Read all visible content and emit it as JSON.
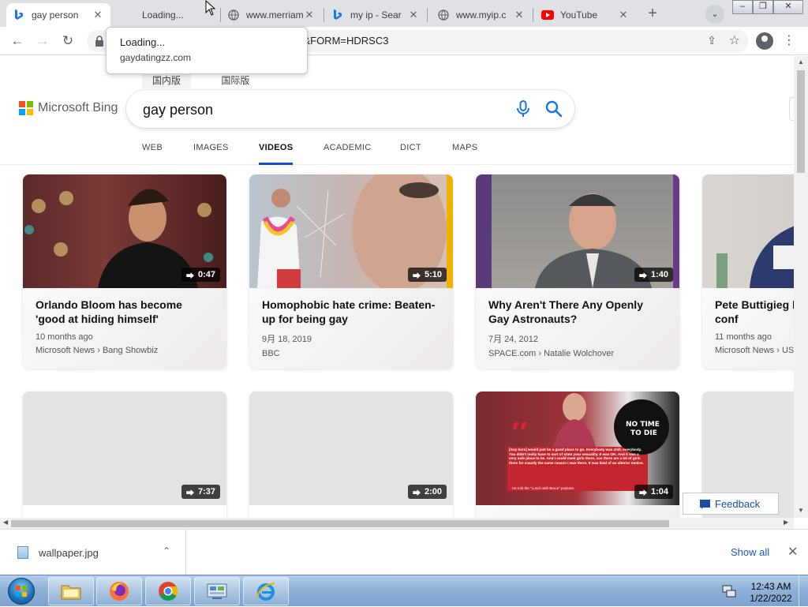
{
  "browser": {
    "tabs": [
      {
        "title": "gay person",
        "favicon": "bing-icon",
        "active": true
      },
      {
        "title": "Loading...",
        "favicon": "none",
        "active": false
      },
      {
        "title": "www.merriam",
        "favicon": "globe-icon",
        "active": false
      },
      {
        "title": "my ip - Sear",
        "favicon": "bing-icon",
        "active": false
      },
      {
        "title": "www.myip.c",
        "favicon": "globe-icon",
        "active": false
      },
      {
        "title": "YouTube",
        "favicon": "youtube-icon",
        "active": false
      }
    ],
    "new_tab": "+",
    "url": "on&FORM=HDRSC3",
    "hover_tooltip": {
      "title": "Loading...",
      "url": "gaydatingzz.com"
    }
  },
  "bing": {
    "lang_links": [
      "国内版",
      "国际版"
    ],
    "logo_text": "Microsoft Bing",
    "query": "gay person",
    "scopes": [
      "WEB",
      "IMAGES",
      "VIDEOS",
      "ACADEMIC",
      "DICT",
      "MAPS"
    ],
    "active_scope": "VIDEOS",
    "feedback": "Feedback"
  },
  "videos": [
    {
      "title": "Orlando Bloom has become 'good at hiding himself'",
      "duration": "0:47",
      "date": "10 months ago",
      "source": "Microsoft News › Bang Showbiz"
    },
    {
      "title": "Homophobic hate crime: Beaten-up for being gay",
      "duration": "5:10",
      "date": "9月 18, 2019",
      "source": "BBC"
    },
    {
      "title": "Why Aren't There Any Openly Gay Astronauts?",
      "duration": "1:40",
      "date": "7月 24, 2012",
      "source": "SPACE.com › Natalie Wolchover"
    },
    {
      "title": "Pete Buttigieg be gay Senate-conf",
      "duration": "",
      "date": "11 months ago",
      "source": "Microsoft News › US"
    },
    {
      "title": "",
      "duration": "7:37",
      "date": "",
      "source": ""
    },
    {
      "title": "",
      "duration": "2:00",
      "date": "",
      "source": ""
    },
    {
      "title": "",
      "duration": "1:04",
      "date": "",
      "source": "",
      "overlay_text": "[Gay bars] would just be a good place to go. Everybody was chill, everybody. You didn't really have to sort of state your sexuality. It was OK. And it was a very safe place to be. And I could meet girls there, cos there are a lot of girls there for exactly the same reason I was there. It was kind of an ulterior motive.",
      "overlay_caption": "He told the \"Lunch with Bruce\" podcast."
    }
  ],
  "downloads": {
    "file": "wallpaper.jpg",
    "show_all": "Show all"
  },
  "taskbar": {
    "time": "12:43 AM",
    "date": "1/22/2022"
  }
}
